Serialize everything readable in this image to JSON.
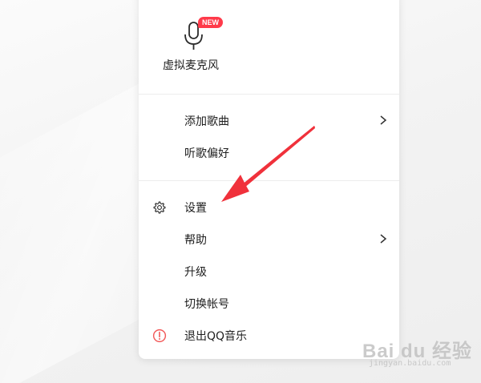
{
  "menu": {
    "mic": {
      "label": "虚拟麦克风",
      "badge": "NEW",
      "icon": "microphone-icon"
    },
    "group1": [
      {
        "label": "添加歌曲",
        "has_submenu": true
      },
      {
        "label": "听歌偏好",
        "has_submenu": false
      }
    ],
    "group2": [
      {
        "label": "设置",
        "icon": "gear-icon",
        "has_submenu": false
      },
      {
        "label": "帮助",
        "has_submenu": true
      },
      {
        "label": "升级",
        "has_submenu": false
      },
      {
        "label": "切换帐号",
        "has_submenu": false
      },
      {
        "label": "退出QQ音乐",
        "icon": "exit-alert-icon",
        "has_submenu": false
      }
    ]
  },
  "colors": {
    "badge": "#ff3a4a",
    "arrow": "#f0313b",
    "exit_icon": "#f25a5a"
  },
  "watermark": {
    "main": "Bai du 经验",
    "sub": "jingyan.baidu.com"
  }
}
